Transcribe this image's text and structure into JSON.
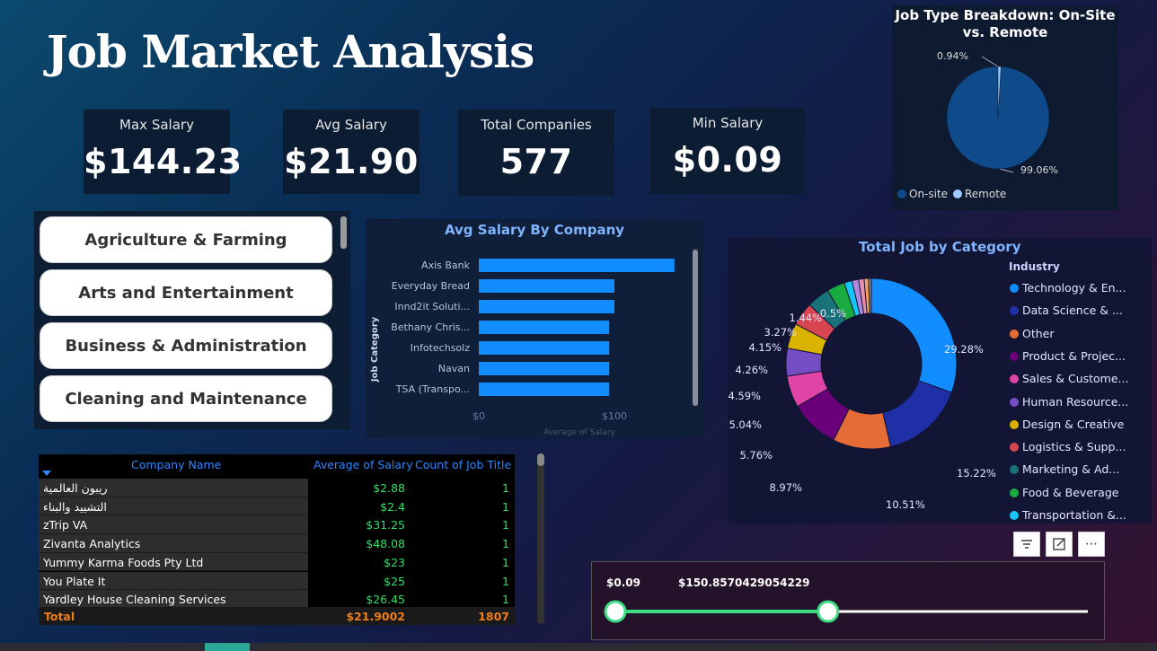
{
  "title": "Job Market Analysis",
  "kpis": {
    "max": {
      "label": "Max Salary",
      "value": "$144.23"
    },
    "avg": {
      "label": "Avg Salary",
      "value": "$21.90"
    },
    "companies": {
      "label": "Total Companies",
      "value": "577"
    },
    "min": {
      "label": "Min Salary",
      "value": "$0.09"
    }
  },
  "slicer": {
    "items": [
      "Agriculture & Farming",
      "Arts and Entertainment",
      "Business & Administration",
      "Cleaning and Maintenance"
    ]
  },
  "pie": {
    "title_line1": "Job Type Breakdown: On-Site",
    "title_line2": "vs. Remote",
    "remote_pct": "0.94%",
    "onsite_pct": "99.06%",
    "legend": [
      {
        "label": "On-site",
        "color": "#0f4a8a"
      },
      {
        "label": "Remote",
        "color": "#9ecbff"
      }
    ]
  },
  "bar_chart": {
    "title": "Avg Salary By Company",
    "ylabel": "Job Category",
    "xlabel": "Average of Salary",
    "tick_labels": [
      "$0",
      "$100"
    ]
  },
  "donut": {
    "title": "Total Job by Category",
    "legend_title": "Industry",
    "legend": [
      {
        "label": "Technology & En...",
        "color": "#118dff"
      },
      {
        "label": "Data Science & ...",
        "color": "#1f2fa6"
      },
      {
        "label": "Other",
        "color": "#e66c37"
      },
      {
        "label": "Product & Projec...",
        "color": "#6b007b"
      },
      {
        "label": "Sales & Custome...",
        "color": "#e044a7"
      },
      {
        "label": "Human Resource...",
        "color": "#744ec2"
      },
      {
        "label": "Design & Creative",
        "color": "#d9b300"
      },
      {
        "label": "Logistics & Supp...",
        "color": "#d64550"
      },
      {
        "label": "Marketing & Ad...",
        "color": "#197278"
      },
      {
        "label": "Food & Beverage",
        "color": "#1aab40"
      },
      {
        "label": "Transportation &...",
        "color": "#15c6f4"
      }
    ],
    "pct_labels": [
      "29.28%",
      "15.22%",
      "10.51%",
      "8.97%",
      "5.76%",
      "5.04%",
      "4.59%",
      "4.26%",
      "4.15%",
      "3.27%",
      "1.44%",
      "0.5%"
    ]
  },
  "table": {
    "headers": [
      "Company Name",
      "Average of Salary",
      "Count of Job Title"
    ],
    "rows": [
      [
        "ريبون العالمية",
        "$2.88",
        "1"
      ],
      [
        "التشييد والبناء",
        "$2.4",
        "1"
      ],
      [
        "zTrip VA",
        "$31.25",
        "1"
      ],
      [
        "Zivanta Analytics",
        "$48.08",
        "1"
      ],
      [
        "Yummy Karma Foods Pty Ltd",
        "$23",
        "1"
      ],
      [
        "You Plate It",
        "$25",
        "1"
      ],
      [
        "Yardley House Cleaning Services",
        "$26.45",
        "1"
      ]
    ],
    "total": {
      "label": "Total",
      "salary": "$21.9002",
      "count": "1807"
    }
  },
  "range_slider": {
    "min_label": "$0.09",
    "max_label": "$150.8570429054229",
    "low_fraction": 0.0,
    "high_fraction": 0.45
  },
  "toolbar": {
    "filter_icon": "filter-icon",
    "focus_icon": "focus-mode-icon",
    "more_icon": "more-options-icon"
  },
  "chart_data": [
    {
      "type": "bar",
      "title": "Avg Salary By Company",
      "ylabel": "Job Category",
      "xlabel": "Average of Salary",
      "categories": [
        "Axis Bank",
        "Everyday Bread",
        "Innd2it Soluti...",
        "Bethany Chris...",
        "Infotechsolz",
        "Navan",
        "TSA (Transpo..."
      ],
      "values": [
        144.23,
        100,
        100,
        96.15,
        96.15,
        96.15,
        96.15
      ],
      "xlim": [
        0,
        150
      ],
      "colors": {
        "bar": "#118dff"
      }
    },
    {
      "type": "pie",
      "title": "Job Type Breakdown: On-Site vs. Remote",
      "categories": [
        "On-site",
        "Remote"
      ],
      "values": [
        99.06,
        0.94
      ]
    },
    {
      "type": "pie",
      "title": "Total Job by Category",
      "categories": [
        "Technology & En...",
        "Data Science & ...",
        "Other",
        "Product & Projec...",
        "Sales & Custome...",
        "Human Resource...",
        "Design & Creative",
        "Logistics & Supp...",
        "Marketing & Ad...",
        "Food & Beverage",
        "Transportation &..."
      ],
      "values": [
        29.28,
        15.22,
        10.51,
        8.97,
        5.76,
        5.04,
        4.59,
        4.26,
        4.15,
        3.27,
        1.44
      ],
      "other_small_slices": [
        1.2,
        1.0,
        0.8,
        0.5
      ]
    }
  ]
}
